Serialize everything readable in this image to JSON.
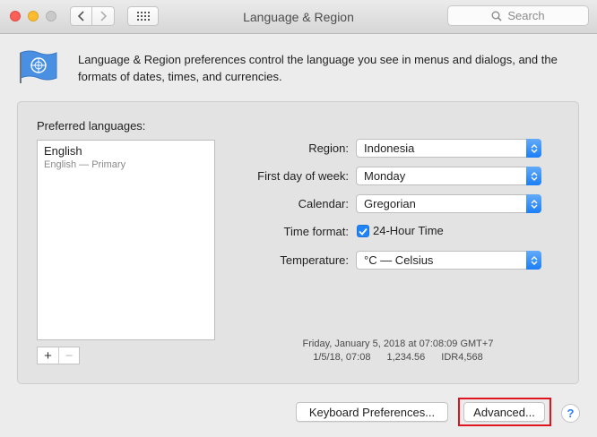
{
  "window": {
    "title": "Language & Region",
    "search_placeholder": "Search"
  },
  "intro": {
    "text": "Language & Region preferences control the language you see in menus and dialogs, and the formats of dates, times, and currencies."
  },
  "languages": {
    "label": "Preferred languages:",
    "items": [
      {
        "name": "English",
        "sub": "English — Primary"
      }
    ],
    "add_label": "+",
    "remove_label": "−"
  },
  "settings": {
    "region_label": "Region:",
    "region_value": "Indonesia",
    "first_day_label": "First day of week:",
    "first_day_value": "Monday",
    "calendar_label": "Calendar:",
    "calendar_value": "Gregorian",
    "time_format_label": "Time format:",
    "time_format_checkbox": "24-Hour Time",
    "time_format_checked": true,
    "temperature_label": "Temperature:",
    "temperature_value": "°C — Celsius"
  },
  "sample": {
    "datetime": "Friday, January 5, 2018 at 07:08:09 GMT+7",
    "short_date": "1/5/18, 07:08",
    "number": "1,234.56",
    "currency": "IDR4,568"
  },
  "buttons": {
    "keyboard": "Keyboard Preferences...",
    "advanced": "Advanced...",
    "help": "?"
  },
  "colors": {
    "accent": "#1b7ff6",
    "highlight": "#e0141e"
  }
}
